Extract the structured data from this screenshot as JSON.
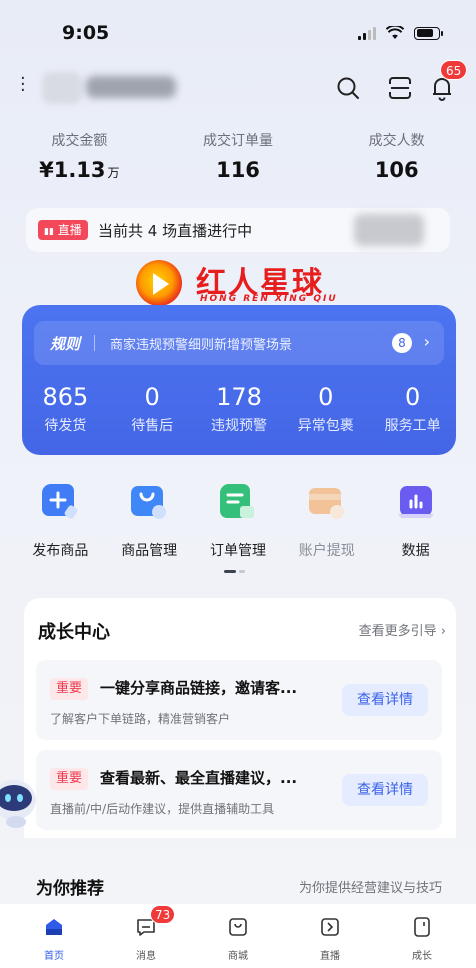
{
  "status_bar": {
    "time": "9:05"
  },
  "header": {
    "notification_count": "65"
  },
  "stats": [
    {
      "label": "成交金额",
      "value": "¥1.13",
      "unit": "万"
    },
    {
      "label": "成交订单量",
      "value": "116",
      "unit": ""
    },
    {
      "label": "成交人数",
      "value": "106",
      "unit": ""
    }
  ],
  "live": {
    "tag": "直播",
    "text": "当前共 4 场直播进行中"
  },
  "watermark": {
    "title": "红人星球",
    "subtitle": "HONG REN XING QIU"
  },
  "rules": {
    "title": "规则",
    "text": "商家违规预警细则新增预警场景",
    "count": "8",
    "arrow": "›"
  },
  "metrics": [
    {
      "value": "865",
      "label": "待发货"
    },
    {
      "value": "0",
      "label": "待售后"
    },
    {
      "value": "178",
      "label": "违规预警"
    },
    {
      "value": "0",
      "label": "异常包裹"
    },
    {
      "value": "0",
      "label": "服务工单"
    }
  ],
  "quick_actions": [
    {
      "label": "发布商品",
      "icon": "publish-product-icon",
      "color": "#3f7cf6"
    },
    {
      "label": "商品管理",
      "icon": "product-management-icon",
      "color": "#3f87f6"
    },
    {
      "label": "订单管理",
      "icon": "order-management-icon",
      "color": "#34c07a"
    },
    {
      "label": "账户提现",
      "icon": "withdraw-icon",
      "color": "#f5a45a"
    },
    {
      "label": "数据",
      "icon": "data-chart-icon",
      "color": "#6a5cf0"
    }
  ],
  "growth": {
    "title": "成长中心",
    "more": "查看更多引导 ›",
    "tasks": [
      {
        "tag": "重要",
        "title": "一键分享商品链接，邀请客...",
        "desc": "了解客户下单链路，精准营销客户",
        "button": "查看详情"
      },
      {
        "tag": "重要",
        "title": "查看最新、最全直播建议，...",
        "desc": "直播前/中/后动作建议，提供直播辅助工具",
        "button": "查看详情"
      }
    ]
  },
  "recommend": {
    "title": "为你推荐",
    "subtitle": "为你提供经营建议与技巧"
  },
  "tabbar": [
    {
      "label": "首页",
      "icon": "home-icon",
      "badge": ""
    },
    {
      "label": "消息",
      "icon": "message-icon",
      "badge": "73"
    },
    {
      "label": "商城",
      "icon": "mall-icon",
      "badge": ""
    },
    {
      "label": "直播",
      "icon": "live-icon",
      "badge": ""
    },
    {
      "label": "成长",
      "icon": "growth-icon",
      "badge": ""
    }
  ],
  "colors": {
    "accent": "#4466e6",
    "badge": "#f03a3a",
    "tag_bg": "#fde7e9",
    "tag_text": "#ef3b4f"
  }
}
